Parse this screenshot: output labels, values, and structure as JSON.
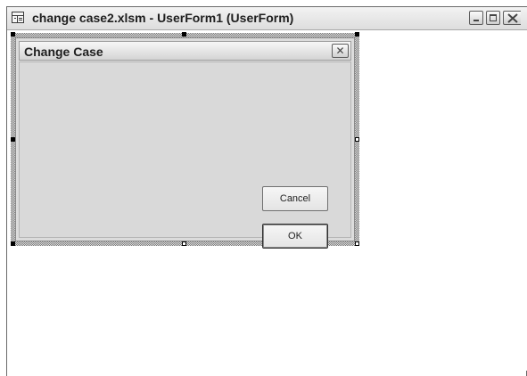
{
  "window": {
    "title": "change case2.xlsm - UserForm1 (UserForm)",
    "icon": "userform-icon",
    "controls": [
      "minimize-icon",
      "maximize-icon",
      "close-icon"
    ]
  },
  "userform": {
    "caption": "Change Case",
    "close_glyph": "✕",
    "buttons": {
      "cancel_label": "Cancel",
      "ok_label": "OK"
    }
  },
  "colors": {
    "form_background": "#d9d9d9",
    "titlebar": "#dddddd",
    "window_background": "#ffffff"
  }
}
